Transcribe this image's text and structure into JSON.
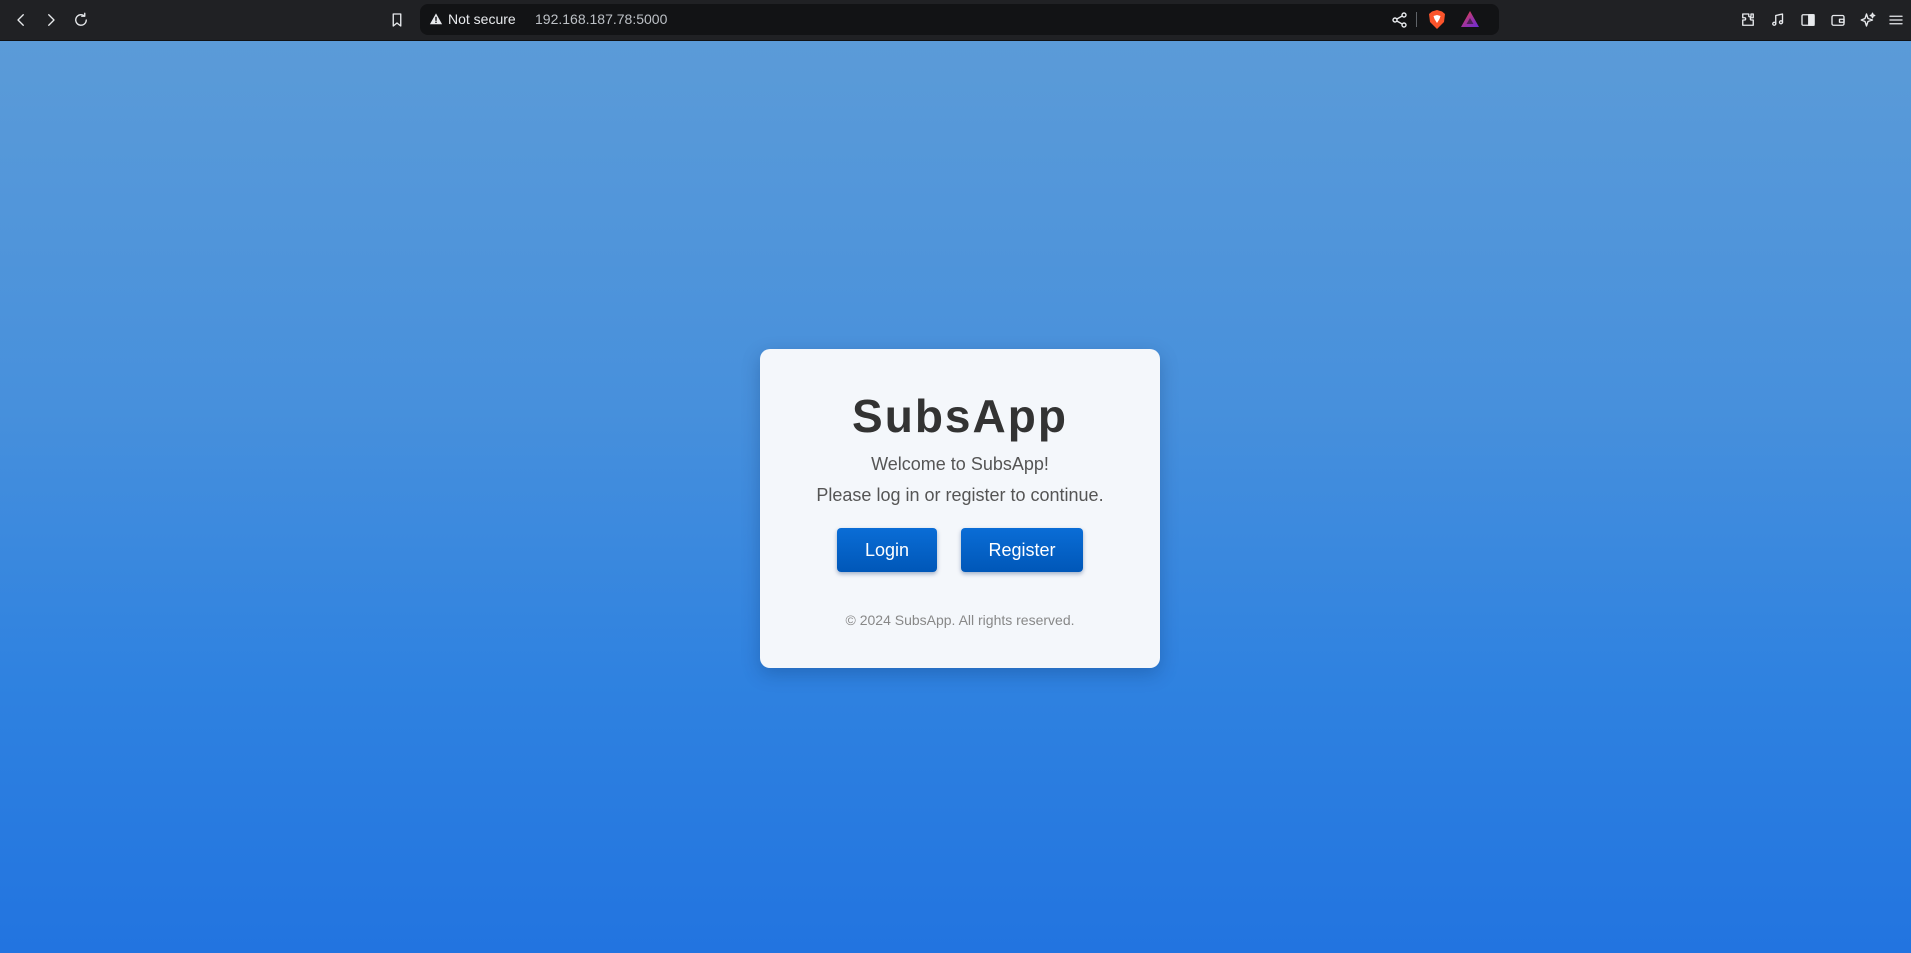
{
  "browser": {
    "security_label": "Not secure",
    "url": "192.168.187.78:5000",
    "icons": [
      "back-icon",
      "forward-icon",
      "reload-icon",
      "bookmark-icon",
      "warning-icon",
      "share-icon",
      "brave-shields-icon",
      "brave-rewards-icon",
      "extensions-icon",
      "media-icon",
      "sidebar-icon",
      "wallet-icon",
      "leo-ai-icon",
      "menu-icon"
    ]
  },
  "page": {
    "background_top": "#5b9bd8",
    "background_bottom": "#2274e0",
    "title": "SubsApp",
    "welcome": "Welcome to SubsApp!",
    "prompt": "Please log in or register to continue.",
    "login_label": "Login",
    "register_label": "Register",
    "button_color": "#0a6dd6",
    "footer": "© 2024 SubsApp. All rights reserved."
  }
}
